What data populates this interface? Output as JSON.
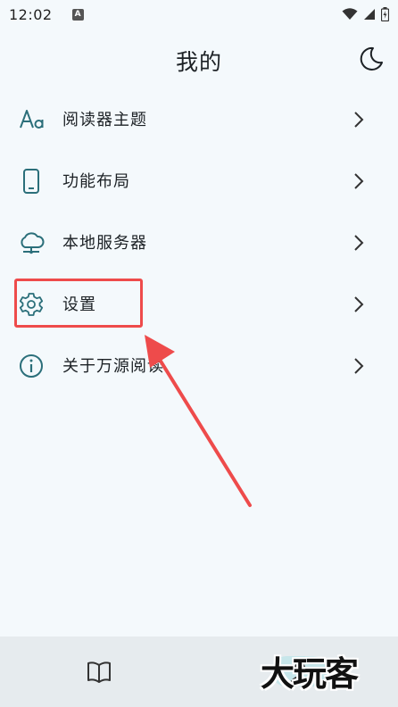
{
  "status_bar": {
    "time": "12:02",
    "app_icon": "A"
  },
  "header": {
    "title": "我的",
    "theme_icon": "moon-icon"
  },
  "menu": {
    "items": [
      {
        "label": "阅读器主题",
        "icon": "font-aa-icon"
      },
      {
        "label": "功能布局",
        "icon": "phone-icon"
      },
      {
        "label": "本地服务器",
        "icon": "cloud-server-icon"
      },
      {
        "label": "设置",
        "icon": "gear-icon"
      },
      {
        "label": "关于万源阅读",
        "icon": "info-icon"
      }
    ]
  },
  "annotation": {
    "color": "#ee4b4b",
    "highlighted_item": "设置"
  },
  "bottom_nav": {
    "items": [
      "book-icon",
      "profile-icon"
    ],
    "active": "profile-icon"
  },
  "watermark": "大玩客",
  "colors": {
    "icon": "#2b6f7a",
    "background": "#f4f9fc",
    "nav_background": "#e6ebee",
    "active_pill": "#c7e6ea"
  }
}
